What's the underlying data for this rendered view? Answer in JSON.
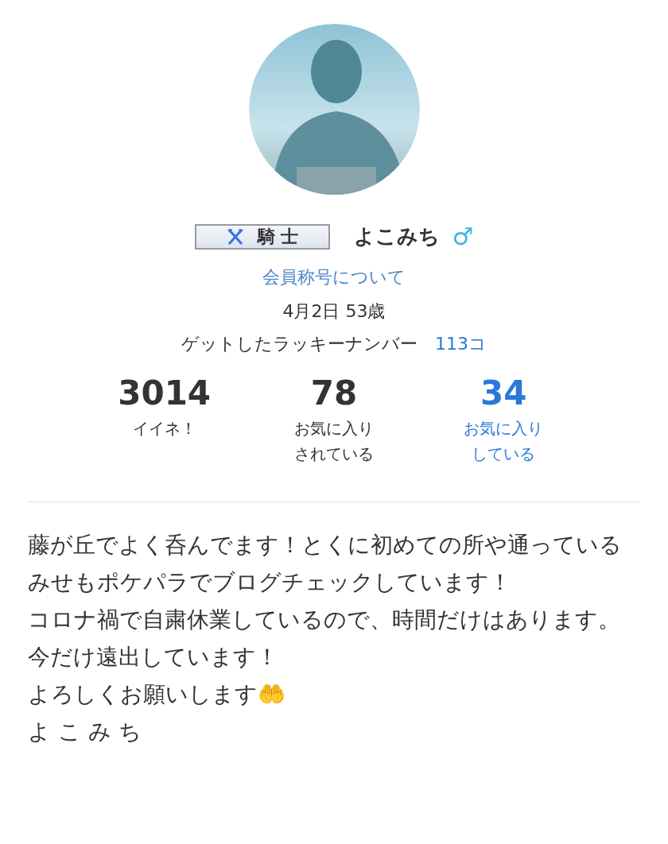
{
  "profile": {
    "rank_badge": "騎 士",
    "name": "よこみち",
    "gender_symbol": "♂",
    "rank_link": "会員称号について",
    "birthday_age": "4月2日 53歳",
    "lucky_label": "ゲットしたラッキーナンバー",
    "lucky_count": "113コ"
  },
  "stats": [
    {
      "value": "3014",
      "label_lines": [
        "イイネ！"
      ],
      "kind": "plain"
    },
    {
      "value": "78",
      "label_lines": [
        "お気に入り",
        "されている"
      ],
      "kind": "plain"
    },
    {
      "value": "34",
      "label_lines": [
        "お気に入り",
        "している"
      ],
      "kind": "link"
    }
  ],
  "bio": [
    "藤が丘でよく呑んでます！とくに初めての所や通っているみせもポケパラでブログチェックしています！",
    "コロナ禍で自粛休業しているので、時間だけはあります。",
    "今だけ遠出しています！",
    "よろしくお願いします🤲",
    "よ こ み ち"
  ]
}
